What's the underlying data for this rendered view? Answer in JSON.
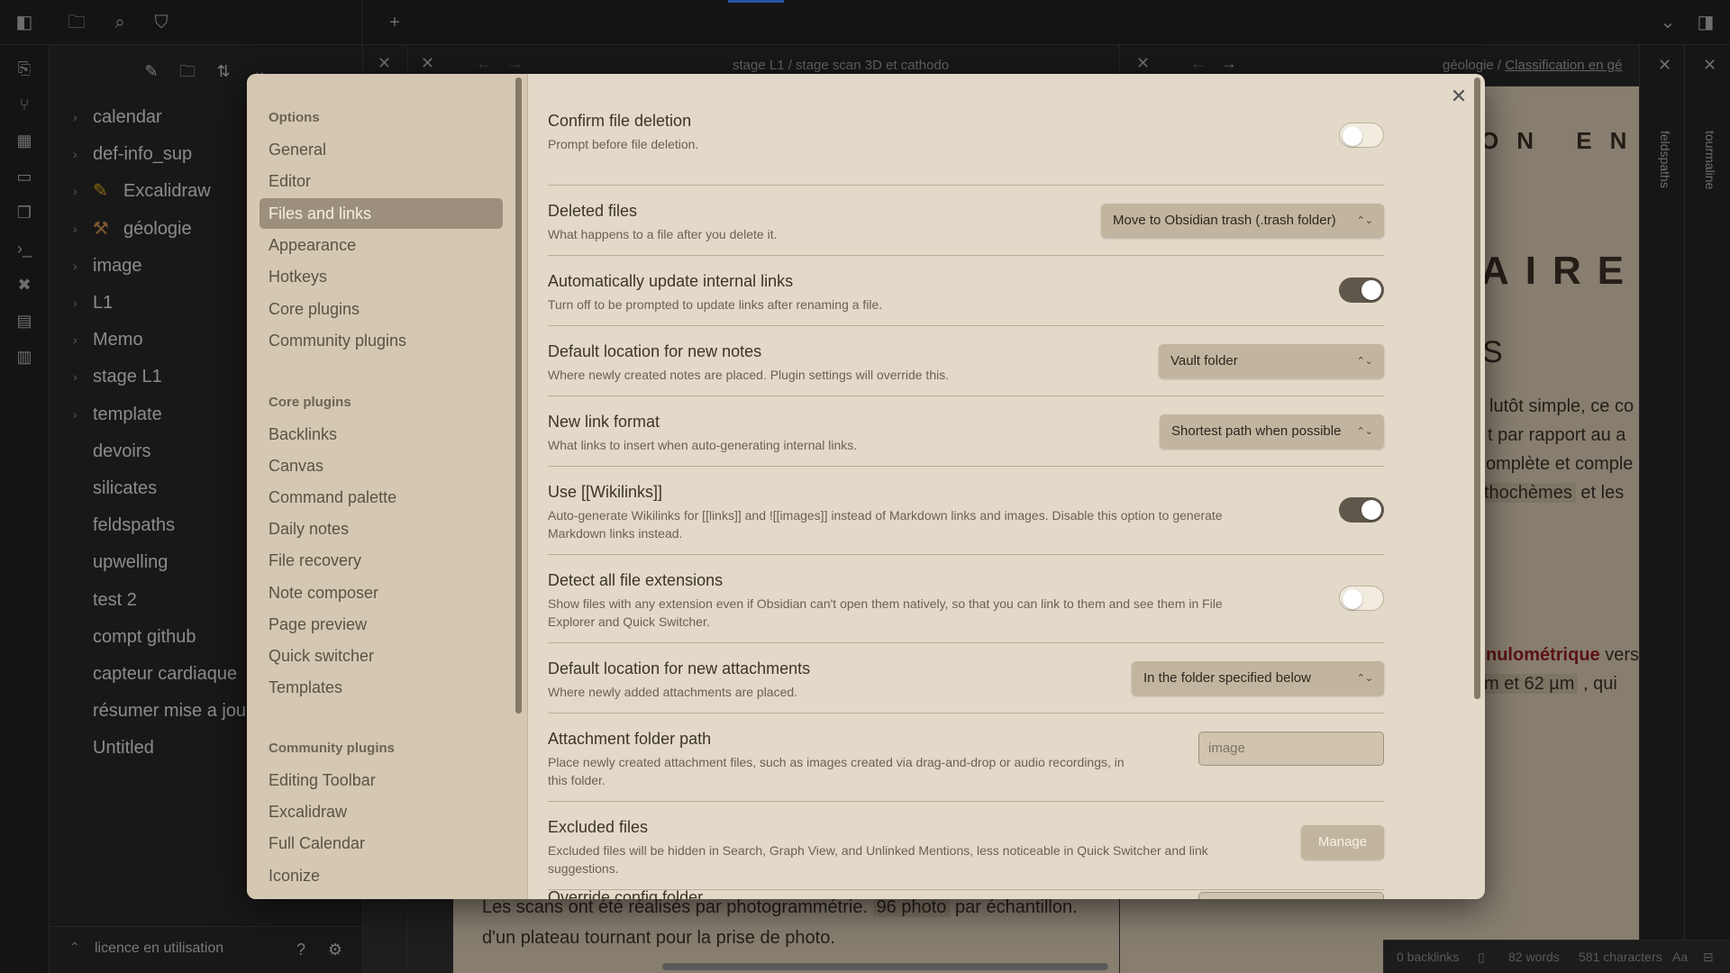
{
  "explorer": {
    "items": [
      {
        "label": "calendar",
        "folder": true
      },
      {
        "label": "def-info_sup",
        "folder": true
      },
      {
        "label": "Excalidraw",
        "folder": true,
        "icon": "pencil-icon"
      },
      {
        "label": "géologie",
        "folder": true,
        "icon": "hammer-icon"
      },
      {
        "label": "image",
        "folder": true
      },
      {
        "label": "L1",
        "folder": true
      },
      {
        "label": "Memo",
        "folder": true
      },
      {
        "label": "stage L1",
        "folder": true
      },
      {
        "label": "template",
        "folder": true
      },
      {
        "label": "devoirs",
        "folder": false
      },
      {
        "label": "silicates",
        "folder": false
      },
      {
        "label": "feldspaths",
        "folder": false
      },
      {
        "label": "upwelling",
        "folder": false
      },
      {
        "label": "test 2",
        "folder": false
      },
      {
        "label": "compt github",
        "folder": false
      },
      {
        "label": "capteur cardiaque",
        "folder": false
      },
      {
        "label": "résumer mise a jour",
        "folder": false
      },
      {
        "label": "Untitled",
        "folder": false
      }
    ],
    "vault_name": "licence en utilisation"
  },
  "panes": {
    "middle_title": "stage L1 / stage scan 3D et cathodo",
    "right_title_prefix": "géologie / ",
    "right_title_link": "Classification en gé",
    "middle_text_line1_a": "Les scans ont été réalisés par photogrammétrie.",
    "middle_text_hl": "96 photo",
    "middle_text_line1_b": "par échantillon.",
    "middle_text_line2": "d'un plateau tournant pour la prise de photo.",
    "right_heading1": "ON EN G",
    "right_heading2": "AIRE",
    "right_heading3": "S",
    "right_text1": "lutôt simple, ce co",
    "right_text2": "t par rapport au a",
    "right_text3": "omplète et comple",
    "right_text4_hl": "thochèmes",
    "right_text4_b": "et les",
    "right_text5_red": "nulométrique",
    "right_text5_b": "vers",
    "right_text6_hl": "m et 62 µm",
    "right_text6_b": ", qui",
    "strip_label_1": "feldspaths",
    "strip_label_2": "tourmaline"
  },
  "statusbar": {
    "backlinks": "0 backlinks",
    "words": "82 words",
    "chars": "581 characters",
    "aa": "Aa"
  },
  "settings_nav": {
    "options_header": "Options",
    "options": [
      "General",
      "Editor",
      "Files and links",
      "Appearance",
      "Hotkeys",
      "Core plugins",
      "Community plugins"
    ],
    "active": "Files and links",
    "core_header": "Core plugins",
    "core": [
      "Backlinks",
      "Canvas",
      "Command palette",
      "Daily notes",
      "File recovery",
      "Note composer",
      "Page preview",
      "Quick switcher",
      "Templates"
    ],
    "community_header": "Community plugins",
    "community": [
      "Editing Toolbar",
      "Excalidraw",
      "Full Calendar",
      "Iconize"
    ]
  },
  "settings": {
    "confirm_deletion": {
      "name": "Confirm file deletion",
      "desc": "Prompt before file deletion.",
      "enabled": false
    },
    "deleted_files": {
      "name": "Deleted files",
      "desc": "What happens to a file after you delete it.",
      "value": "Move to Obsidian trash (.trash folder)"
    },
    "auto_update_links": {
      "name": "Automatically update internal links",
      "desc": "Turn off to be prompted to update links after renaming a file.",
      "enabled": true
    },
    "default_location": {
      "name": "Default location for new notes",
      "desc": "Where newly created notes are placed. Plugin settings will override this.",
      "value": "Vault folder"
    },
    "new_link_format": {
      "name": "New link format",
      "desc": "What links to insert when auto-generating internal links.",
      "value": "Shortest path when possible"
    },
    "wikilinks": {
      "name": "Use [[Wikilinks]]",
      "desc_line1": "Auto-generate Wikilinks for [[links]] and ![[images]] instead of Markdown links and images. Disable this option to generate",
      "desc_line2": "Markdown links instead.",
      "enabled": true
    },
    "detect_extensions": {
      "name": "Detect all file extensions",
      "desc_line1": "Show files with any extension even if Obsidian can't open them natively, so that you can link to them and see them in File",
      "desc_line2": "Explorer and Quick Switcher.",
      "enabled": false
    },
    "attachment_location": {
      "name": "Default location for new attachments",
      "desc": "Where newly added attachments are placed.",
      "value": "In the folder specified below"
    },
    "attachment_path": {
      "name": "Attachment folder path",
      "desc_line1": "Place newly created attachment files, such as images created via drag-and-drop or audio recordings, in",
      "desc_line2": "this folder.",
      "placeholder": "image"
    },
    "excluded_files": {
      "name": "Excluded files",
      "desc_line1": "Excluded files will be hidden in Search, Graph View, and Unlinked Mentions, less noticeable in Quick Switcher and link",
      "desc_line2": "suggestions.",
      "button": "Manage"
    },
    "override_config": {
      "name": "Override config folder"
    }
  }
}
